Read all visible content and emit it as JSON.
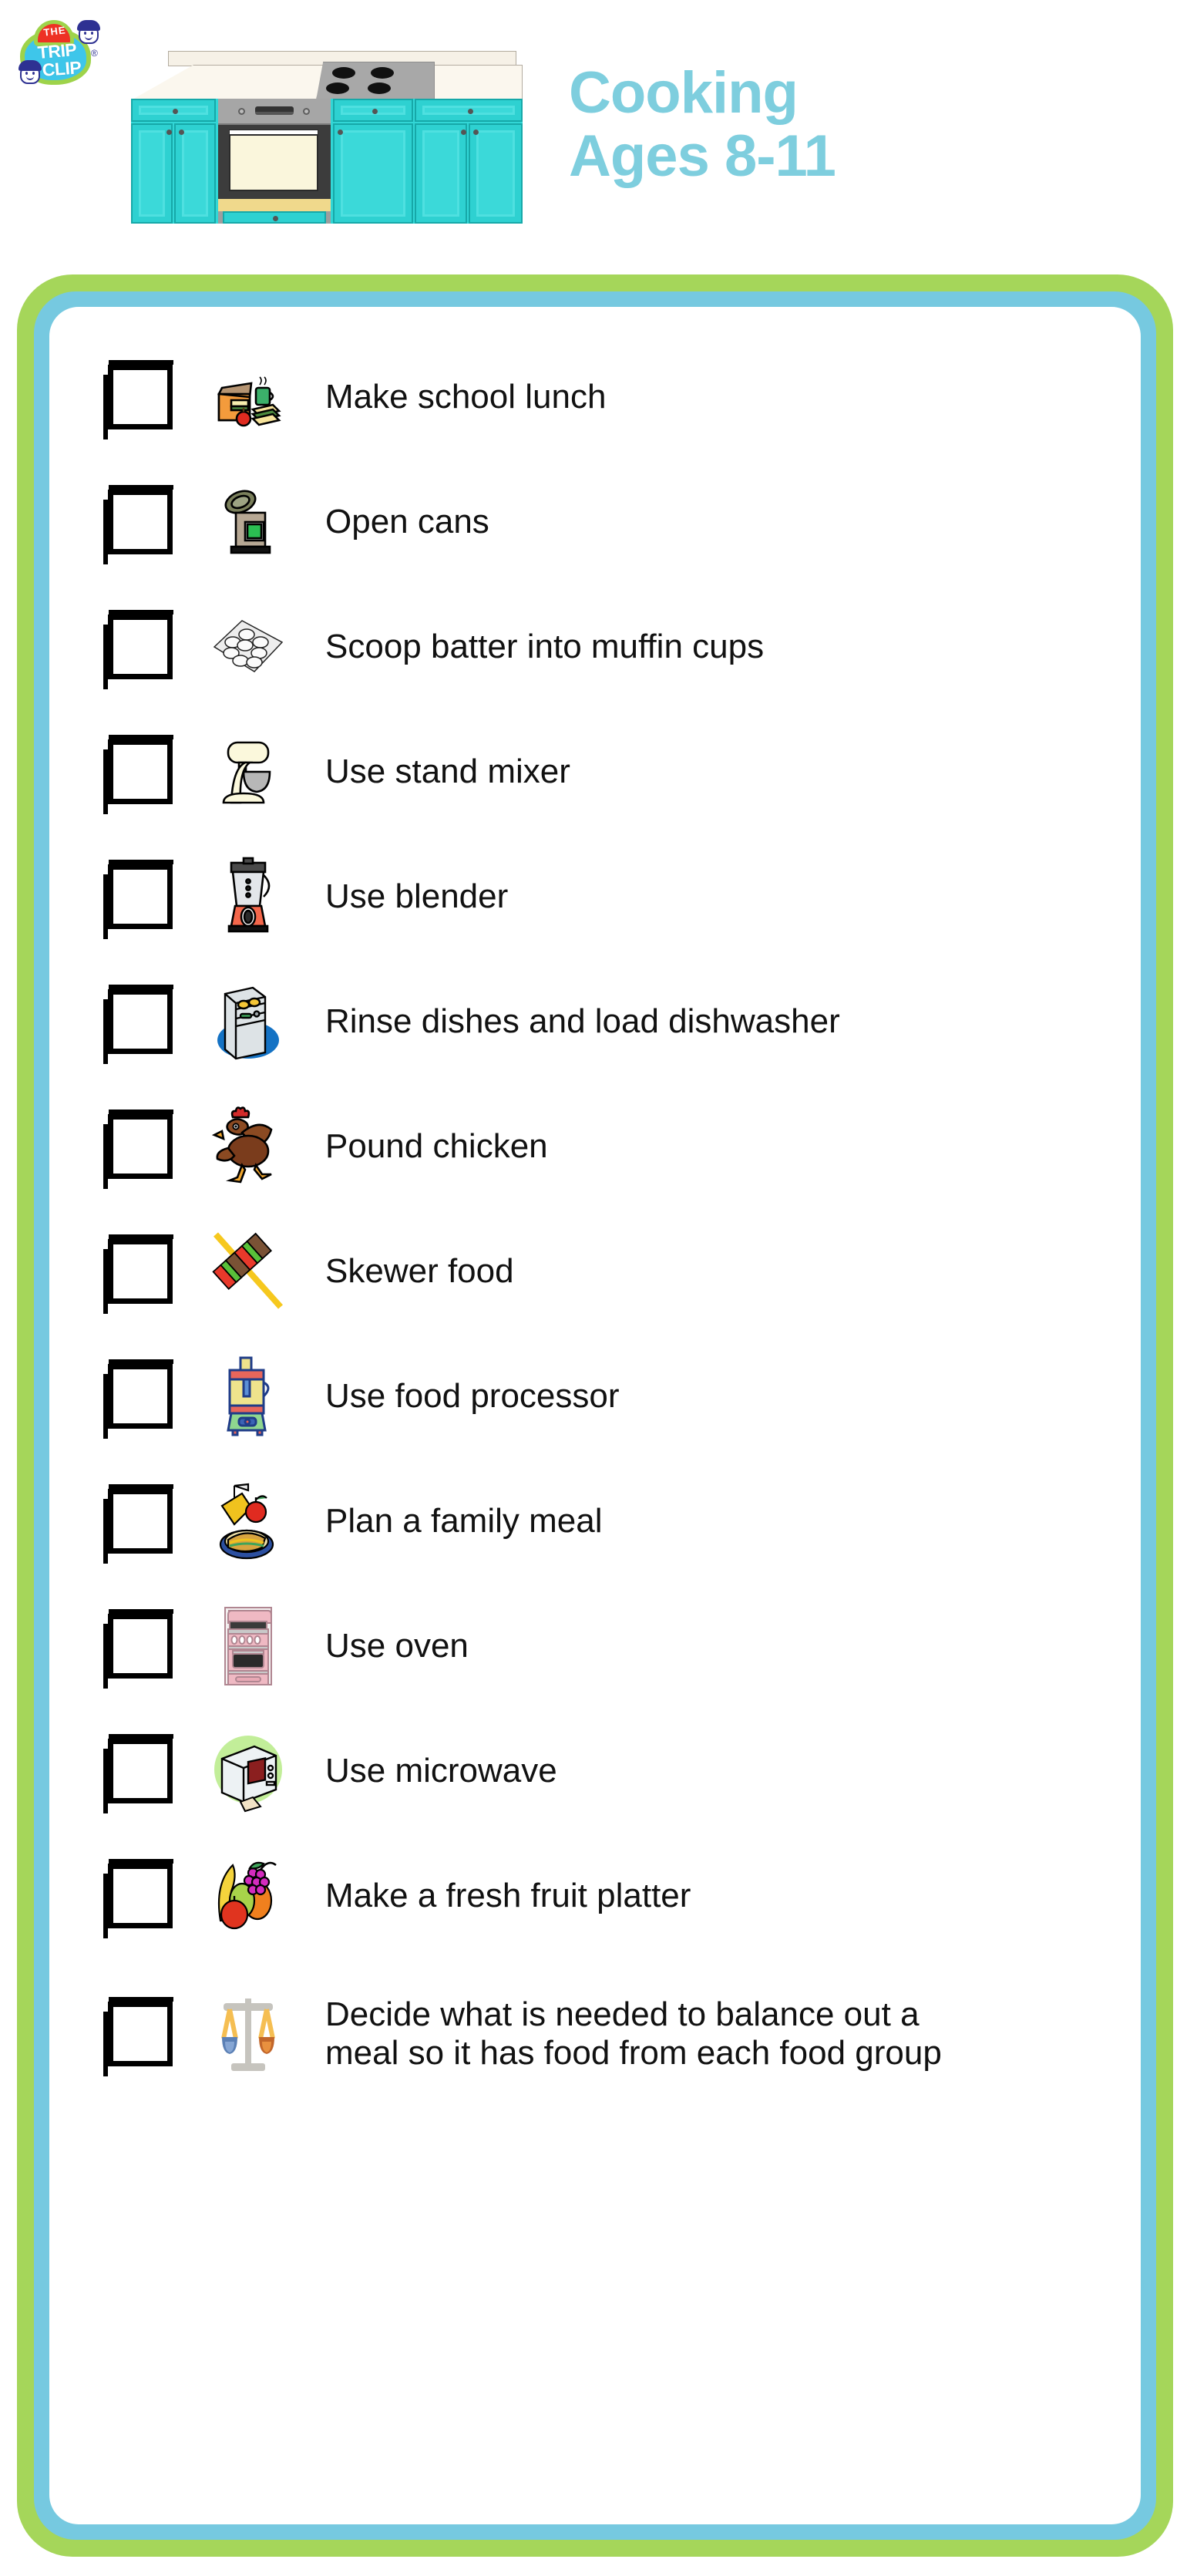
{
  "brand": {
    "logo_name": "The Trip Clip",
    "logo_the": "THE",
    "logo_trip": "TRIP",
    "logo_clip": "CLIP",
    "registered_mark": "®"
  },
  "header": {
    "title_line1": "Cooking",
    "title_line2": "Ages 8-11",
    "illustration": "kitchen-stove-illustration"
  },
  "colors": {
    "title": "#7ECEDE",
    "frame_outer": "#A5D65A",
    "frame_inner": "#76C9E0",
    "cabinet_teal": "#2ED1D1",
    "checkbox_border": "#000000"
  },
  "checklist": {
    "items": [
      {
        "label": "Make school lunch",
        "icon": "lunchbox-icon",
        "checked": false
      },
      {
        "label": "Open cans",
        "icon": "can-opener-icon",
        "checked": false
      },
      {
        "label": "Scoop batter into muffin cups",
        "icon": "muffin-tin-icon",
        "checked": false
      },
      {
        "label": "Use stand mixer",
        "icon": "stand-mixer-icon",
        "checked": false
      },
      {
        "label": "Use blender",
        "icon": "blender-icon",
        "checked": false
      },
      {
        "label": "Rinse dishes and load dishwasher",
        "icon": "dishwasher-icon",
        "checked": false
      },
      {
        "label": "Pound chicken",
        "icon": "chicken-icon",
        "checked": false
      },
      {
        "label": "Skewer food",
        "icon": "kebab-skewer-icon",
        "checked": false
      },
      {
        "label": "Use food processor",
        "icon": "food-processor-icon",
        "checked": false
      },
      {
        "label": "Plan a family meal",
        "icon": "family-meal-icon",
        "checked": false
      },
      {
        "label": "Use oven",
        "icon": "oven-icon",
        "checked": false
      },
      {
        "label": "Use microwave",
        "icon": "microwave-icon",
        "checked": false
      },
      {
        "label": "Make a fresh fruit platter",
        "icon": "fruit-platter-icon",
        "checked": false
      },
      {
        "label": "Decide what is needed to balance out a meal so it has food from each food group",
        "icon": "balance-scale-icon",
        "checked": false
      }
    ]
  }
}
